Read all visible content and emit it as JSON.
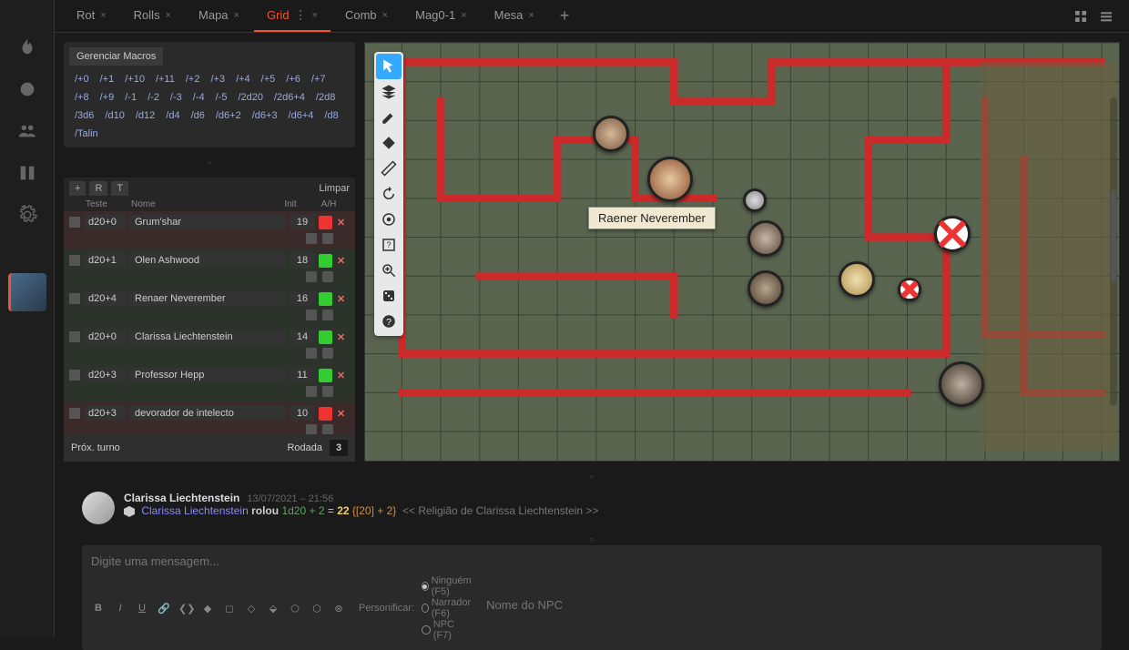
{
  "tabs": [
    {
      "label": "Rot"
    },
    {
      "label": "Rolls"
    },
    {
      "label": "Mapa"
    },
    {
      "label": "Grid",
      "active": true,
      "hasHandle": true
    },
    {
      "label": "Comb"
    },
    {
      "label": "Mag0-1"
    },
    {
      "label": "Mesa"
    }
  ],
  "macros": {
    "header": "Gerenciar Macros",
    "items": [
      "/+0",
      "/+1",
      "/+10",
      "/+11",
      "/+2",
      "/+3",
      "/+4",
      "/+5",
      "/+6",
      "/+7",
      "/+8",
      "/+9",
      "/-1",
      "/-2",
      "/-3",
      "/-4",
      "/-5",
      "/2d20",
      "/2d6+4",
      "/2d8",
      "/3d6",
      "/d10",
      "/d12",
      "/d4",
      "/d6",
      "/d6+2",
      "/d6+3",
      "/d6+4",
      "/d8",
      "/Talin"
    ]
  },
  "init": {
    "buttons": {
      "r": "R",
      "t": "T",
      "clear": "Limpar"
    },
    "cols": {
      "test": "Teste",
      "name": "Nome",
      "init": "Init",
      "ah": "A/H"
    },
    "rows": [
      {
        "test": "d20+0",
        "name": "Grum'shar",
        "init": "19",
        "color": "red",
        "type": "enemy"
      },
      {
        "test": "d20+1",
        "name": "Olen Ashwood",
        "init": "18",
        "color": "green",
        "type": "ally"
      },
      {
        "test": "d20+4",
        "name": "Renaer Neverember",
        "init": "16",
        "color": "green",
        "type": "ally"
      },
      {
        "test": "d20+0",
        "name": "Clarissa Liechtenstein",
        "init": "14",
        "color": "green",
        "type": "ally"
      },
      {
        "test": "d20+3",
        "name": "Professor Hepp",
        "init": "11",
        "color": "green",
        "type": "ally"
      },
      {
        "test": "d20+3",
        "name": "devorador de intelecto",
        "init": "10",
        "color": "red",
        "type": "enemy"
      }
    ],
    "next": "Próx. turno",
    "round_label": "Rodada",
    "round": "3"
  },
  "map": {
    "tooltip": "Raener Neverember"
  },
  "chat": {
    "msg": {
      "name": "Clarissa Liechtenstein",
      "time": "13/07/2021 – 21:56",
      "actor": "Clarissa Liechtenstein",
      "rolled": "rolou",
      "dice": "1d20",
      "plus": "+ 2",
      "eq": "=",
      "total": "22",
      "detail": "{[20] + 2}",
      "extra": "<< Religião de Clarissa Liechtenstein >>"
    },
    "placeholder": "Digite uma mensagem...",
    "personify_label": "Personificar:",
    "opts": [
      {
        "label": "Ninguém (F5)",
        "sel": true
      },
      {
        "label": "Narrador (F6)",
        "sel": false
      },
      {
        "label": "NPC (F7)",
        "sel": false
      }
    ],
    "npc_placeholder": "Nome do NPC"
  }
}
